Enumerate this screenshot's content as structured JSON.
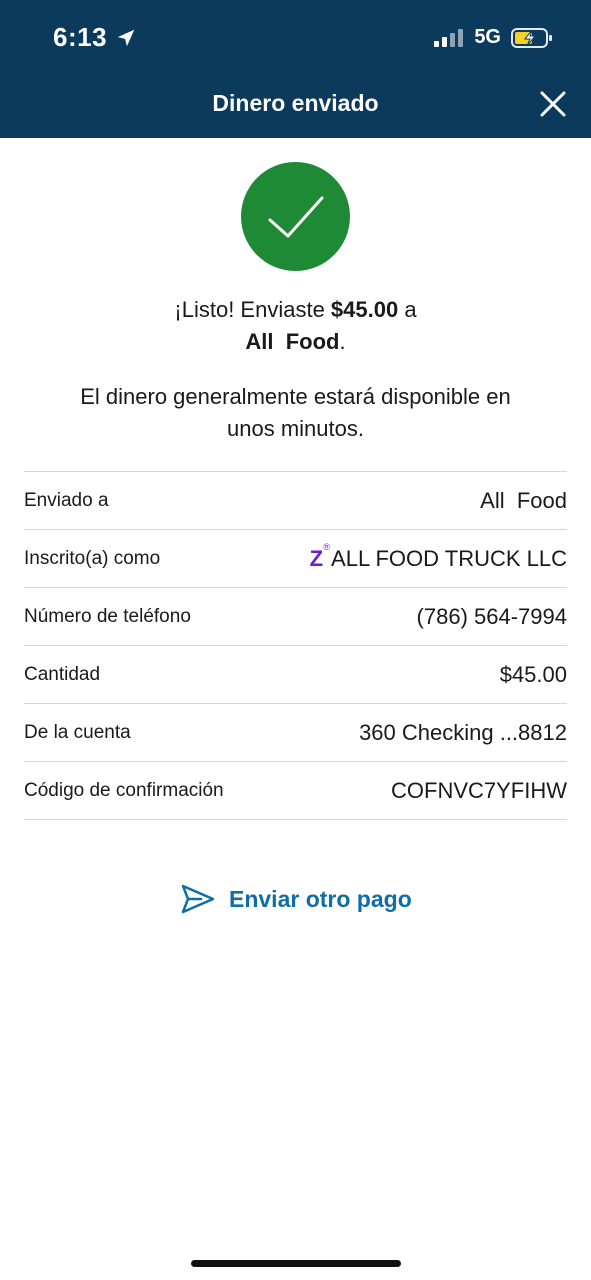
{
  "status_bar": {
    "time": "6:13",
    "network": "5G",
    "icons": [
      "location-arrow-icon",
      "signal-bars-icon",
      "battery-charging-icon"
    ]
  },
  "header": {
    "title": "Dinero enviado",
    "close_icon": "close-icon",
    "background": "#0b3a5c"
  },
  "confirmation": {
    "icon": "checkmark-icon",
    "icon_color": "#1f8a35",
    "prefix": "¡Listo! Enviaste ",
    "amount": "$45.00",
    "connector": " a",
    "recipient": "All  Food",
    "suffix": ".",
    "availability": "El dinero generalmente estará disponible en unos minutos."
  },
  "details": [
    {
      "label": "Enviado a",
      "value": "All  Food"
    },
    {
      "label": "Inscrito(a) como",
      "value": "ALL FOOD TRUCK LLC",
      "zelle_badge": "Z",
      "zelle_mark": "®"
    },
    {
      "label": "Número de teléfono",
      "value": "(786) 564-7994"
    },
    {
      "label": "Cantidad",
      "value": "$45.00"
    },
    {
      "label": "De la cuenta",
      "value": "360 Checking ...8812"
    },
    {
      "label": "Código de confirmación",
      "value": "COFNVC7YFIHW"
    }
  ],
  "actions": {
    "send_again_label": "Enviar otro pago",
    "send_again_icon": "send-arrow-icon",
    "link_color": "#0f6ea6"
  }
}
